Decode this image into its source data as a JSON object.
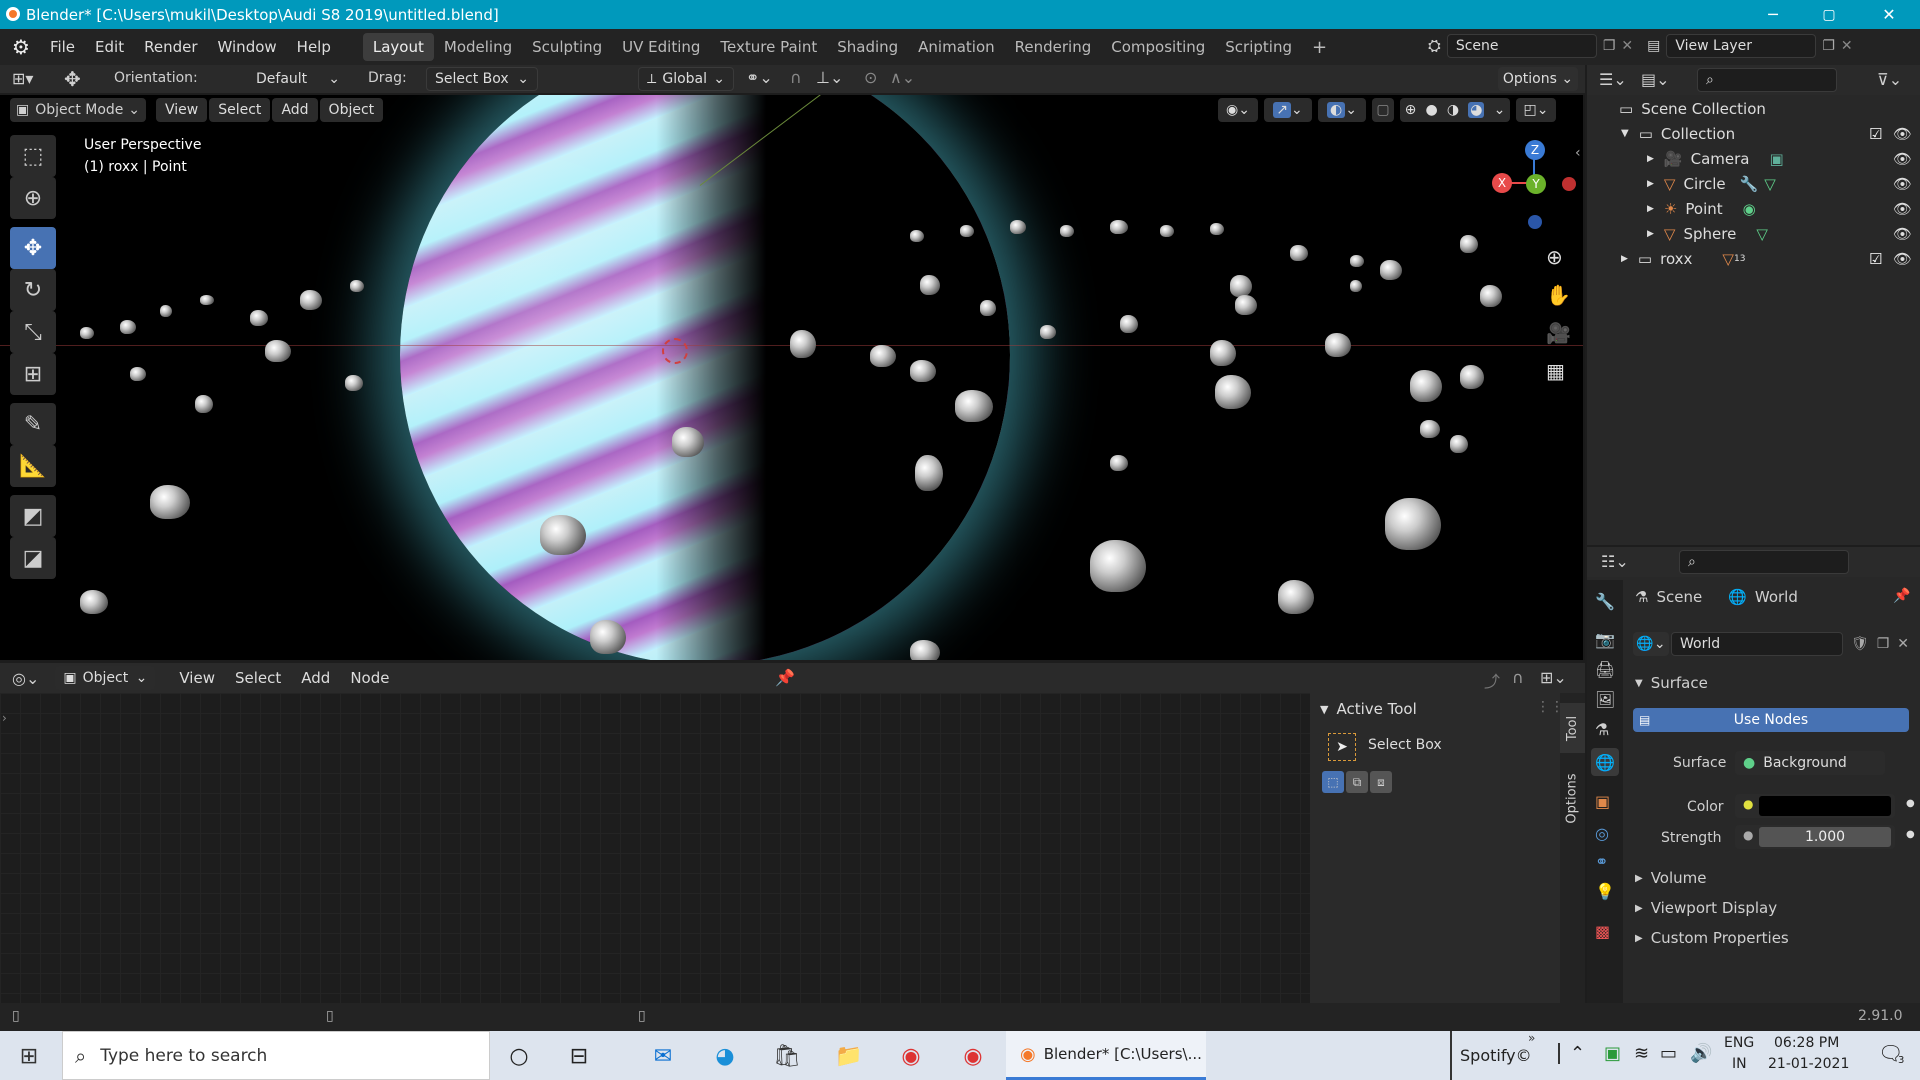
{
  "window": {
    "title": "Blender* [C:\\Users\\mukil\\Desktop\\Audi S8 2019\\untitled.blend]",
    "min": "─",
    "max": "▢",
    "close": "✕"
  },
  "menus": [
    "File",
    "Edit",
    "Render",
    "Window",
    "Help"
  ],
  "workspaces": [
    "Layout",
    "Modeling",
    "Sculpting",
    "UV Editing",
    "Texture Paint",
    "Shading",
    "Animation",
    "Rendering",
    "Compositing",
    "Scripting"
  ],
  "add_workspace": "+",
  "scene": {
    "name": "Scene",
    "view_layer": "View Layer"
  },
  "toolheader": {
    "orientation_label": "Orientation:",
    "orientation_value": "Default",
    "drag_label": "Drag:",
    "drag_value": "Select Box",
    "transform_orientation": "Global",
    "options": "Options"
  },
  "viewport": {
    "mode": "Object Mode",
    "menus": [
      "View",
      "Select",
      "Add",
      "Object"
    ],
    "perspective": "User Perspective",
    "object_info": "(1) roxx | Point",
    "axes": {
      "x": "X",
      "y": "Y",
      "z": "Z"
    }
  },
  "node_editor": {
    "type": "Object",
    "menus": [
      "View",
      "Select",
      "Add",
      "Node"
    ]
  },
  "active_tool": {
    "heading": "Active Tool",
    "tool_name": "Select Box",
    "tabs": [
      "Tool",
      "Options"
    ]
  },
  "outliner": {
    "root": "Scene Collection",
    "collection": "Collection",
    "items": [
      {
        "name": "Camera"
      },
      {
        "name": "Circle"
      },
      {
        "name": "Point"
      },
      {
        "name": "Sphere"
      }
    ],
    "roxx": {
      "name": "roxx",
      "count": "13"
    }
  },
  "properties": {
    "breadcrumb_scene": "Scene",
    "breadcrumb_world": "World",
    "world_name": "World",
    "surface_section": "Surface",
    "use_nodes": "Use Nodes",
    "surface_label": "Surface",
    "surface_value": "Background",
    "color_label": "Color",
    "color_value": "#000000",
    "strength_label": "Strength",
    "strength_value": "1.000",
    "volume": "Volume",
    "viewport_display": "Viewport Display",
    "custom_properties": "Custom Properties"
  },
  "status": {
    "version": "2.91.0"
  },
  "taskbar": {
    "search_placeholder": "Type here to search",
    "blender_task": "Blender* [C:\\Users\\...",
    "spotify": "Spotify©",
    "lang_top": "ENG",
    "lang_bottom": "IN",
    "time": "06:28 PM",
    "date": "21-01-2021",
    "notifications": "3"
  },
  "colors": {
    "titlebar": "#0099bc",
    "accent": "#4772b3",
    "planet_cyan": "#bff3ff",
    "planet_magenta": "#b45fc8"
  }
}
